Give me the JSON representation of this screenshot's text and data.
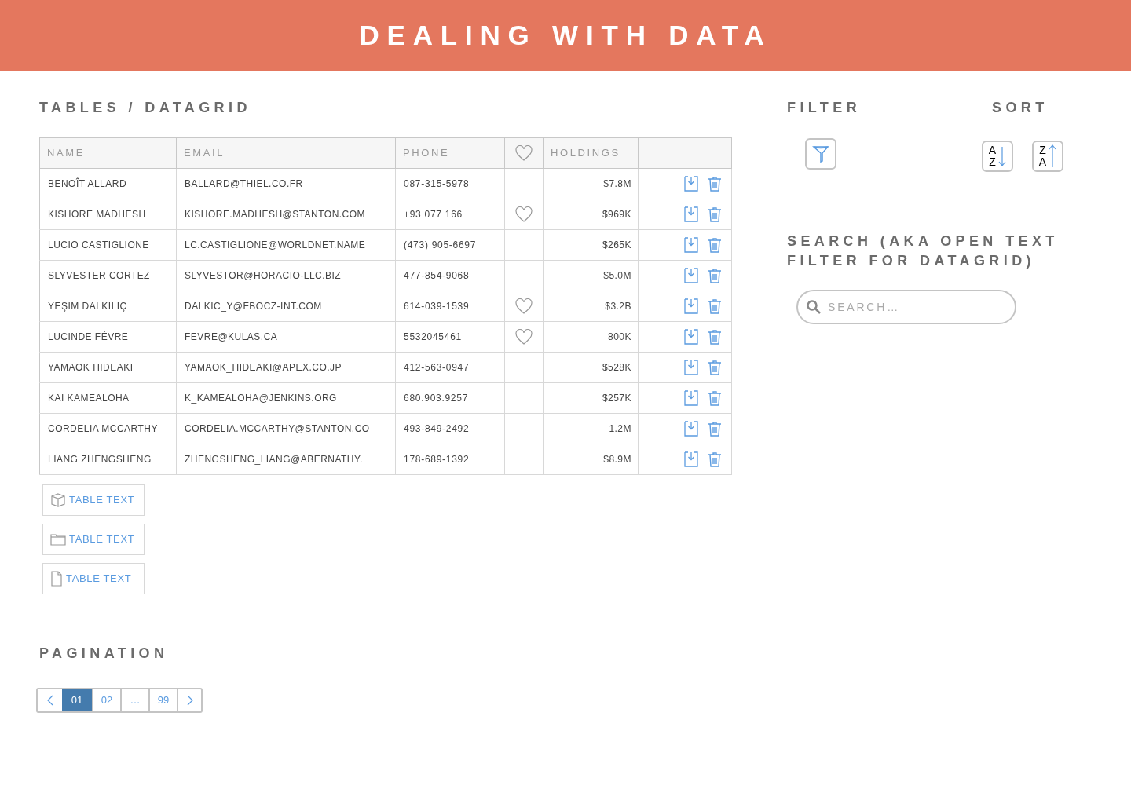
{
  "header": {
    "title": "DEALING WITH DATA"
  },
  "tables_section": {
    "heading": "TABLES / DATAGRID"
  },
  "table": {
    "columns": [
      "NAME",
      "EMAIL",
      "PHONE",
      "HOLDINGS"
    ],
    "rows": [
      {
        "name": "BENOÎT ALLARD",
        "email": "BALLARD@THIEL.CO.FR",
        "phone": "087-315-5978",
        "favorite": false,
        "holdings": "$7.8M"
      },
      {
        "name": "KISHORE MADHESH",
        "email": "KISHORE.MADHESH@STANTON.COM",
        "phone": "+93 077 166",
        "favorite": true,
        "holdings": "$969K"
      },
      {
        "name": "LUCIO CASTIGLIONE",
        "email": "LC.CASTIGLIONE@WORLDNET.NAME",
        "phone": "(473) 905-6697",
        "favorite": false,
        "holdings": "$265K"
      },
      {
        "name": "SLYVESTER CORTEZ",
        "email": "SLYVESTOR@HORACIO-LLC.BIZ",
        "phone": "477-854-9068",
        "favorite": false,
        "holdings": "$5.0M"
      },
      {
        "name": "YEŞIM DALKILIÇ",
        "email": "DALKIC_Y@FBOCZ-INT.COM",
        "phone": "614-039-1539",
        "favorite": true,
        "holdings": "$3.2B"
      },
      {
        "name": "LUCINDE FÉVRE",
        "email": "FEVRE@KULAS.CA",
        "phone": "5532045461",
        "favorite": true,
        "holdings": "800K"
      },
      {
        "name": "YAMAOK HIDEAKI",
        "email": "YAMAOK_HIDEAKI@APEX.CO.JP",
        "phone": "412-563-0947",
        "favorite": false,
        "holdings": "$528K"
      },
      {
        "name": "KAI KAMEĀLOHA",
        "email": "K_KAMEALOHA@JENKINS.ORG",
        "phone": "680.903.9257",
        "favorite": false,
        "holdings": "$257K"
      },
      {
        "name": "CORDELIA MCCARTHY",
        "email": "CORDELIA.MCCARTHY@STANTON.CO",
        "phone": "493-849-2492",
        "favorite": false,
        "holdings": "1.2M"
      },
      {
        "name": "LIANG ZHENGSHENG",
        "email": "ZHENGSHENG_LIANG@ABERNATHY.",
        "phone": "178-689-1392",
        "favorite": false,
        "holdings": "$8.9M"
      }
    ]
  },
  "text_buttons": [
    {
      "kind": "cube",
      "label": "TABLE TEXT"
    },
    {
      "kind": "folder",
      "label": "TABLE TEXT"
    },
    {
      "kind": "file",
      "label": "TABLE TEXT"
    }
  ],
  "pagination": {
    "heading": "PAGINATION",
    "pages": [
      {
        "label": "01",
        "selected": true
      },
      {
        "label": "02",
        "selected": false
      },
      {
        "label": "…",
        "selected": false
      },
      {
        "label": "99",
        "selected": false
      }
    ]
  },
  "filter": {
    "heading": "FILTER"
  },
  "sort": {
    "heading": "SORT",
    "buttons": [
      {
        "kind": "ascending",
        "top": "A",
        "bottom": "Z"
      },
      {
        "kind": "descending",
        "top": "Z",
        "bottom": "A"
      }
    ]
  },
  "search": {
    "heading": "SEARCH (AKA OPEN TEXT FILTER FOR DATAGRID)",
    "placeholder": "SEARCH…"
  }
}
